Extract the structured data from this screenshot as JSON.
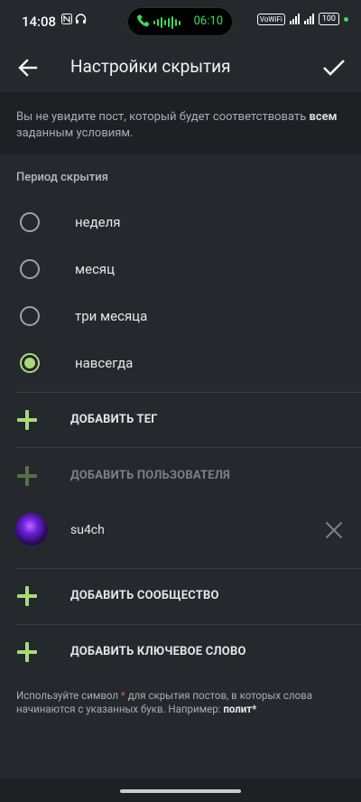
{
  "status_bar": {
    "time": "14:08",
    "left_icons": [
      "nfc-icon",
      "headset-icon"
    ],
    "call_duration": "06:10",
    "volte_label": "VoWiFi",
    "battery": "100",
    "accent_color": "#3ddc58"
  },
  "app_bar": {
    "title": "Настройки скрытия"
  },
  "notice": {
    "text_before": "Вы не увидите пост, который будет соответствовать ",
    "text_bold": "всем",
    "text_after": " заданным условиям."
  },
  "period": {
    "label": "Период скрытия",
    "options": [
      {
        "label": "неделя",
        "selected": false
      },
      {
        "label": "месяц",
        "selected": false
      },
      {
        "label": "три месяца",
        "selected": false
      },
      {
        "label": "навсегда",
        "selected": true
      }
    ]
  },
  "actions": {
    "add_tag": "ДОБАВИТЬ ТЕГ",
    "add_user": "ДОБАВИТЬ ПОЛЬЗОВАТЕЛЯ",
    "add_community": "ДОБАВИТЬ СООБЩЕСТВО",
    "add_keyword": "ДОБАВИТЬ КЛЮЧЕВОЕ СЛОВО"
  },
  "users": [
    {
      "name": "su4ch"
    }
  ],
  "hint": {
    "before": "Используйте символ ",
    "star": "*",
    "middle": " для скрытия постов, в которых слова начинаются с указанных букв. Например: ",
    "example": "полит*"
  },
  "colors": {
    "accent": "#a6dc7a",
    "background": "#25282c",
    "panel": "#1e2124"
  }
}
